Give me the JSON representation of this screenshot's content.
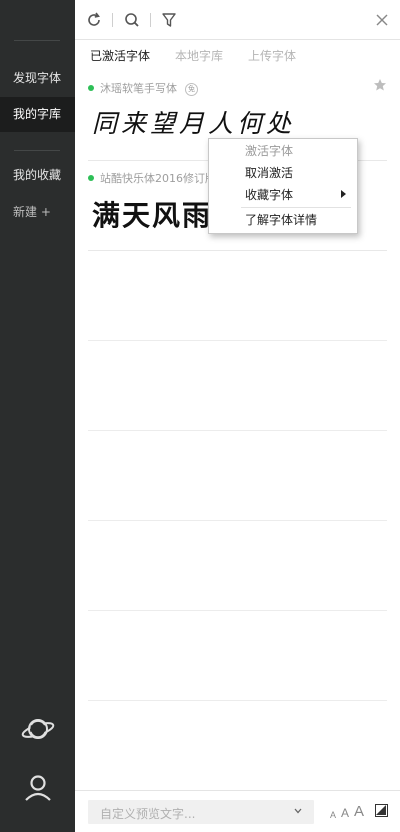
{
  "sidebar": {
    "items": [
      {
        "label": "发现字体"
      },
      {
        "label": "我的字库"
      },
      {
        "label": "我的收藏"
      }
    ],
    "new_label": "新建 +",
    "bottom_icons": [
      "planet-icon",
      "user-icon"
    ]
  },
  "toolbar": {
    "icons": [
      "refresh-icon",
      "search-icon",
      "filter-icon",
      "close-icon"
    ]
  },
  "tabs": [
    {
      "label": "已激活字体",
      "active": true
    },
    {
      "label": "本地字库",
      "active": false
    },
    {
      "label": "上传字体",
      "active": false
    }
  ],
  "fonts": [
    {
      "name": "沐瑶软笔手写体",
      "badge": "免",
      "preview": "同来望月人何处",
      "active": true
    },
    {
      "name": "站酷快乐体2016修订版",
      "preview": "满天风雨",
      "active": true
    }
  ],
  "context_menu": {
    "items": [
      {
        "label": "激活字体",
        "disabled": true
      },
      {
        "label": "取消激活",
        "disabled": false
      },
      {
        "label": "收藏字体",
        "disabled": false,
        "has_submenu": true
      },
      {
        "label": "了解字体详情",
        "disabled": false
      }
    ]
  },
  "bottom_bar": {
    "preview_placeholder": "自定义预览文字...",
    "size_labels": [
      "A",
      "A",
      "A"
    ],
    "icons": [
      "chevron-down-icon",
      "contrast-icon"
    ]
  },
  "colors": {
    "sidebar_bg": "#2b2d2d",
    "sidebar_active_bg": "#1c1d1d",
    "active_dot": "#2dbf57"
  }
}
